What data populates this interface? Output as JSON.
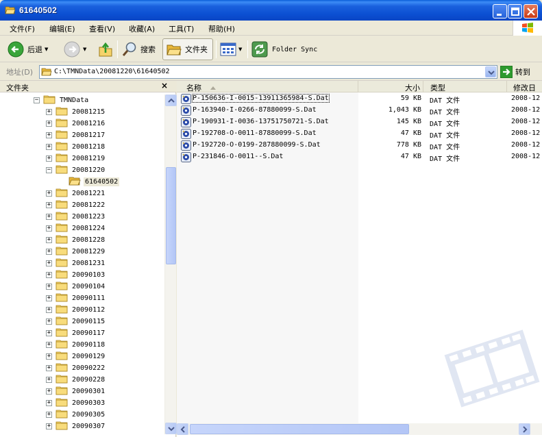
{
  "window": {
    "title": "61640502",
    "buttons": {
      "minimize": "minimize",
      "maximize": "maximize",
      "close": "close"
    }
  },
  "menu": [
    "文件(F)",
    "编辑(E)",
    "查看(V)",
    "收藏(A)",
    "工具(T)",
    "帮助(H)"
  ],
  "toolbar": {
    "back": "后退",
    "search": "搜索",
    "folders": "文件夹",
    "folder_sync": "Folder Sync"
  },
  "address": {
    "label": "地址(D)",
    "path": "C:\\TMNData\\20081220\\61640502",
    "go": "转到"
  },
  "folder_pane": {
    "title": "文件夹",
    "close": "×",
    "tree": [
      {
        "label": "TMNData",
        "expander": "−",
        "level": 0
      },
      {
        "label": "20081215",
        "expander": "+",
        "level": 1
      },
      {
        "label": "20081216",
        "expander": "+",
        "level": 1
      },
      {
        "label": "20081217",
        "expander": "+",
        "level": 1
      },
      {
        "label": "20081218",
        "expander": "+",
        "level": 1
      },
      {
        "label": "20081219",
        "expander": "+",
        "level": 1
      },
      {
        "label": "20081220",
        "expander": "−",
        "level": 1
      },
      {
        "label": "61640502",
        "expander": "",
        "level": 2,
        "selected": true,
        "open": true
      },
      {
        "label": "20081221",
        "expander": "+",
        "level": 1
      },
      {
        "label": "20081222",
        "expander": "+",
        "level": 1
      },
      {
        "label": "20081223",
        "expander": "+",
        "level": 1
      },
      {
        "label": "20081224",
        "expander": "+",
        "level": 1
      },
      {
        "label": "20081228",
        "expander": "+",
        "level": 1
      },
      {
        "label": "20081229",
        "expander": "+",
        "level": 1
      },
      {
        "label": "20081231",
        "expander": "+",
        "level": 1
      },
      {
        "label": "20090103",
        "expander": "+",
        "level": 1
      },
      {
        "label": "20090104",
        "expander": "+",
        "level": 1
      },
      {
        "label": "20090111",
        "expander": "+",
        "level": 1
      },
      {
        "label": "20090112",
        "expander": "+",
        "level": 1
      },
      {
        "label": "20090115",
        "expander": "+",
        "level": 1
      },
      {
        "label": "20090117",
        "expander": "+",
        "level": 1
      },
      {
        "label": "20090118",
        "expander": "+",
        "level": 1
      },
      {
        "label": "20090129",
        "expander": "+",
        "level": 1
      },
      {
        "label": "20090222",
        "expander": "+",
        "level": 1
      },
      {
        "label": "20090228",
        "expander": "+",
        "level": 1
      },
      {
        "label": "20090301",
        "expander": "+",
        "level": 1
      },
      {
        "label": "20090303",
        "expander": "+",
        "level": 1
      },
      {
        "label": "20090305",
        "expander": "+",
        "level": 1
      },
      {
        "label": "20090307",
        "expander": "+",
        "level": 1
      }
    ]
  },
  "file_list": {
    "columns": {
      "name": "名称",
      "size": "大小",
      "type": "类型",
      "modified": "修改日"
    },
    "files": [
      {
        "name": "P-150636-I-0015-13911365984-S.Dat",
        "size": "59 KB",
        "type": "DAT 文件",
        "modified": "2008-12"
      },
      {
        "name": "P-163940-I-0266-87880099-S.Dat",
        "size": "1,043 KB",
        "type": "DAT 文件",
        "modified": "2008-12"
      },
      {
        "name": "P-190931-I-0036-13751750721-S.Dat",
        "size": "145 KB",
        "type": "DAT 文件",
        "modified": "2008-12"
      },
      {
        "name": "P-192708-O-0011-87880099-S.Dat",
        "size": "47 KB",
        "type": "DAT 文件",
        "modified": "2008-12"
      },
      {
        "name": "P-192720-O-0199-287880099-S.Dat",
        "size": "778 KB",
        "type": "DAT 文件",
        "modified": "2008-12"
      },
      {
        "name": "P-231846-O-0011--S.Dat",
        "size": "47 KB",
        "type": "DAT 文件",
        "modified": "2008-12"
      }
    ]
  },
  "colors": {
    "titlebar": "#0A4FD2",
    "chrome": "#ECE9D8",
    "folder": "#F5D36B",
    "selection": "#ECE9D8"
  }
}
